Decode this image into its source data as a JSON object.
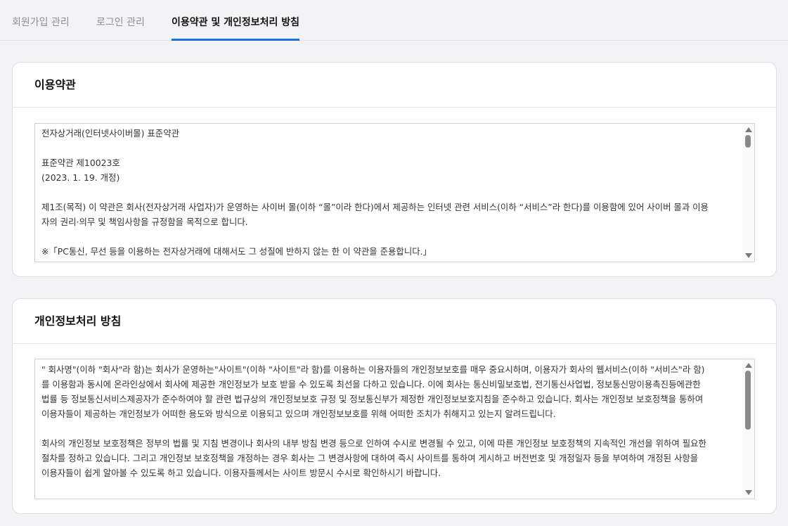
{
  "tabs": [
    {
      "label": "회원가입 관리",
      "active": false
    },
    {
      "label": "로그인 관리",
      "active": false
    },
    {
      "label": "이용약관 및 개인정보처리 방침",
      "active": true
    }
  ],
  "terms": {
    "title": "이용약관",
    "lines": [
      "전자상거래(인터넷사이버몰) 표준약관",
      "",
      "표준약관 제10023호",
      "(2023. 1. 19. 개정)",
      "",
      "제1조(목적) 이 약관은 회사(전자상거래 사업자)가 운영하는 사이버 몰(이하 “몰”이라 한다)에서 제공하는 인터넷 관련 서비스(이하 “서비스”라 한다)를 이용함에 있어 사이버 몰과 이용",
      "자의 권리·의무 및 책임사항을 규정함을 목적으로 합니다.",
      "",
      "※「PC통신, 무선 등을 이용하는 전자상거래에 대해서도 그 성질에 반하지 않는 한 이 약관을 준용합니다.」"
    ]
  },
  "privacy": {
    "title": "개인정보처리 방침",
    "lines": [
      "\" 회사명\"(이하 \"회사\"라 함)는 회사가 운영하는\"사이트\"(이하 \"사이트\"라 함)를 이용하는 이용자들의 개인정보보호를 매우 중요시하며, 이용자가 회사의 웹서비스(이하 \"서비스\"라 함)",
      "를 이용함과 동시에 온라인상에서 회사에 제공한 개인정보가 보호 받을 수 있도록 최선을 다하고 있습니다. 이에 회사는 통신비밀보호법, 전기통신사업법, 정보통신망이용촉진등에관한",
      "법률 등 정보통신서비스제공자가 준수하여야 할 관련 법규상의 개인정보보호 규정 및 정보통신부가 제정한 개인정보보호지침을 준수하고 있습니다. 회사는 개인정보 보호정책을 통하여",
      "이용자들이 제공하는 개인정보가 어떠한 용도와 방식으로 이용되고 있으며 개인정보보호를 위해 어떠한 조치가 취해지고 있는지 알려드립니다.",
      "",
      "회사의 개인정보 보호정책은 정부의 법률 및 지침 변경이나 회사의 내부 방침 변경 등으로 인하여 수시로 변경될 수 있고, 이에 따른 개인정보 보호정책의 지속적인 개선을 위하여 필요한",
      "절차를 정하고 있습니다. 그리고 개인정보 보호정책을 개정하는 경우 회사는 그 변경사항에 대하여 즉시 사이트를 통하여 게시하고 버전번호 및 개정일자 등을 부여하여 개정된 사항을",
      "이용자들이 쉽게 알아볼 수 있도록 하고 있습니다. 이용자들께서는 사이트 방문시 수시로 확인하시기 바랍니다."
    ]
  }
}
